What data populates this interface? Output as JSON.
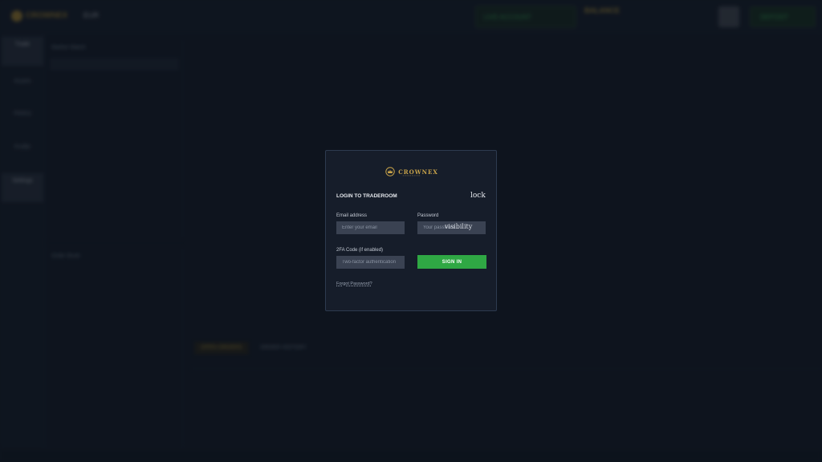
{
  "background": {
    "logo_text": "CROWNEX",
    "top_chip": "EUR",
    "account_box": "LIVE ACCOUNT",
    "balance": "BALANCE",
    "deposit": "DEPOSIT",
    "nav_items": [
      "Trade",
      "Assets",
      "History",
      "Profile",
      "Settings"
    ],
    "panel_top_title": "Market Watch",
    "panel_bottom_title": "Order Book",
    "bottom_tab_active": "OPEN ORDERS",
    "bottom_tab_other": "ORDER HISTORY"
  },
  "modal": {
    "brand_name": "CROWNEX",
    "title": "LOGIN TO TRADEROOM",
    "lock_icon_glyph": "lock",
    "email_label": "Email address",
    "email_placeholder": "Enter your email",
    "email_value": "",
    "password_label": "Password",
    "password_placeholder": "Your password",
    "password_value": "",
    "visibility_icon_glyph": "visibility",
    "twofa_label": "2FA Code (if enabled)",
    "twofa_placeholder": "Two-factor authentication",
    "twofa_value": "",
    "signin_label": "SIGN IN",
    "forgot_label": "Forgot Password?"
  },
  "colors": {
    "accent_gold": "#c9a44a",
    "signin_green": "#2fa844",
    "modal_bg": "#161d2a",
    "input_bg": "#3a4252"
  },
  "icons": {
    "lock": "lock-icon",
    "visibility": "visibility-icon",
    "brand": "crown-logo-icon"
  }
}
